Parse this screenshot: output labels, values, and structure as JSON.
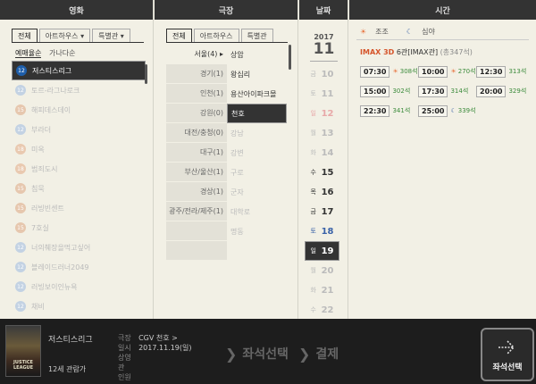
{
  "movie_col": {
    "header": "영화",
    "tabs": [
      "전체",
      "아트하우스",
      "특별관"
    ],
    "sort": [
      "예매율순",
      "가나다순"
    ],
    "items": [
      {
        "age": "12",
        "title": "저스티스리그"
      },
      {
        "age": "12",
        "title": "토르-라그나로크"
      },
      {
        "age": "15",
        "title": "해피데스데이"
      },
      {
        "age": "12",
        "title": "부라더"
      },
      {
        "age": "18",
        "title": "미옥"
      },
      {
        "age": "18",
        "title": "범죄도시"
      },
      {
        "age": "15",
        "title": "침묵"
      },
      {
        "age": "15",
        "title": "러빙빈센트"
      },
      {
        "age": "15",
        "title": "7호실"
      },
      {
        "age": "12",
        "title": "너의췌장을먹고싶어"
      },
      {
        "age": "12",
        "title": "블레이드러너2049"
      },
      {
        "age": "12",
        "title": "러빙보이인뉴욕"
      },
      {
        "age": "12",
        "title": "채비"
      }
    ]
  },
  "theater_col": {
    "header": "극장",
    "tabs": [
      "전체",
      "아트하우스",
      "특별관"
    ],
    "regions": [
      "서울(4)",
      "경기(1)",
      "인천(1)",
      "강원(0)",
      "대전/충청(0)",
      "대구(1)",
      "부산/울산(1)",
      "경상(1)",
      "광주/전라/제주(1)"
    ],
    "cinemas": [
      "상암",
      "왕십리",
      "용산아이파크몰",
      "천호",
      "강남",
      "강변",
      "구로",
      "군자",
      "대학로",
      "명동"
    ]
  },
  "date_col": {
    "header": "날짜",
    "year": "2017",
    "month": "11",
    "days": [
      {
        "dow": "금",
        "day": "10"
      },
      {
        "dow": "토",
        "day": "11"
      },
      {
        "dow": "일",
        "day": "12"
      },
      {
        "dow": "월",
        "day": "13"
      },
      {
        "dow": "화",
        "day": "14"
      },
      {
        "dow": "수",
        "day": "15"
      },
      {
        "dow": "목",
        "day": "16"
      },
      {
        "dow": "금",
        "day": "17"
      },
      {
        "dow": "토",
        "day": "18"
      },
      {
        "dow": "일",
        "day": "19"
      },
      {
        "dow": "월",
        "day": "20"
      },
      {
        "dow": "화",
        "day": "21"
      },
      {
        "dow": "수",
        "day": "22"
      }
    ]
  },
  "time_col": {
    "header": "시간",
    "legend": {
      "morning": "조조",
      "night": "심야"
    },
    "hall": {
      "format": "IMAX 3D",
      "name": "6관[IMAX관]",
      "seats": "(총347석)"
    },
    "times": [
      {
        "time": "07:30",
        "seats": "308석",
        "icon": "sun"
      },
      {
        "time": "10:00",
        "seats": "270석",
        "icon": "sun"
      },
      {
        "time": "12:30",
        "seats": "313석",
        "icon": ""
      },
      {
        "time": "15:00",
        "seats": "302석",
        "icon": ""
      },
      {
        "time": "17:30",
        "seats": "314석",
        "icon": ""
      },
      {
        "time": "20:00",
        "seats": "329석",
        "icon": ""
      },
      {
        "time": "22:30",
        "seats": "341석",
        "icon": ""
      },
      {
        "time": "25:00",
        "seats": "339석",
        "icon": "moon"
      }
    ]
  },
  "summary": {
    "title": "저스티스리그",
    "rating": "12세 관람가",
    "poster_text": "JUSTICE LEAGUE",
    "theater_label": "극장",
    "theater_value": "CGV 천호 >",
    "date_label": "일시",
    "date_value": "2017.11.19(일)",
    "hall_label": "상영관",
    "hall_value": "",
    "people_label": "인원",
    "people_value": "",
    "step1": "좌석선택",
    "step2": "결제",
    "button": "좌석선택"
  },
  "colors": {
    "accent": "#d5542a",
    "selected": "#333333",
    "saturday": "#3a62a8",
    "seats": "#3a8a3a"
  }
}
